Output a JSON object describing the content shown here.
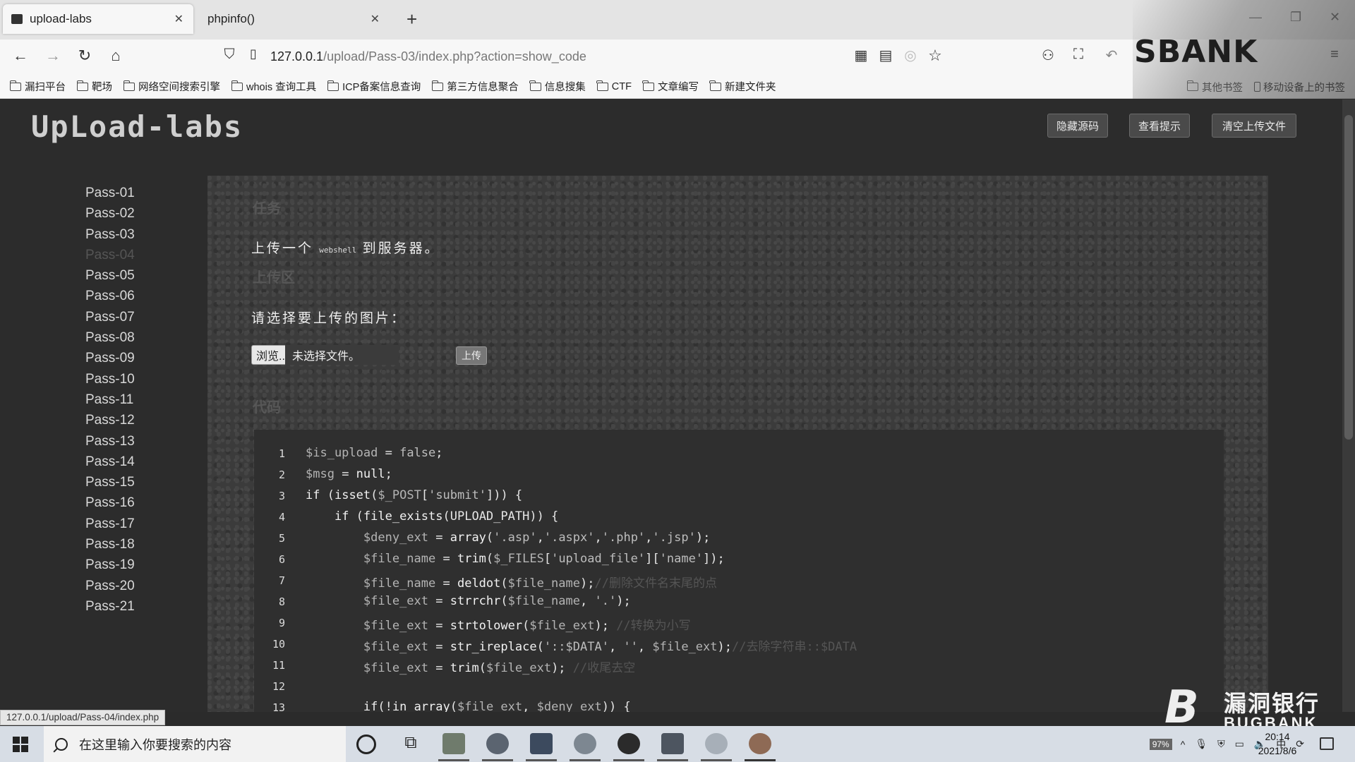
{
  "browser": {
    "tabs": [
      {
        "label": "upload-labs",
        "active": true
      },
      {
        "label": "phpinfo()",
        "active": false
      }
    ],
    "new_tab_glyph": "+",
    "address": {
      "host": "127.0.0.1",
      "path": "/upload/Pass-03/index.php?action=show_code"
    },
    "bookmarks": [
      "漏扫平台",
      "靶场",
      "网络空间搜索引擎",
      "whois 查询工具",
      "ICP备案信息查询",
      "第三方信息聚合",
      "信息搜集",
      "CTF",
      "文章编写",
      "新建文件夹"
    ],
    "bookmarks_right": [
      "其他书签",
      "移动设备上的书签"
    ],
    "overlay_logo": "SBANK"
  },
  "site": {
    "logo": "UpLoad-labs",
    "buttons": {
      "hide_source": "隐藏源码",
      "view_hint": "查看提示",
      "clear_uploads": "清空上传文件"
    },
    "menu": [
      "Pass-01",
      "Pass-02",
      "Pass-03",
      "Pass-04",
      "Pass-05",
      "Pass-06",
      "Pass-07",
      "Pass-08",
      "Pass-09",
      "Pass-10",
      "Pass-11",
      "Pass-12",
      "Pass-13",
      "Pass-14",
      "Pass-15",
      "Pass-16",
      "Pass-17",
      "Pass-18",
      "Pass-19",
      "Pass-20",
      "Pass-21"
    ],
    "task": {
      "title": "任务",
      "desc_before": "上传一个",
      "desc_code": "webshell",
      "desc_after": "到服务器。"
    },
    "upload": {
      "title": "上传区",
      "prompt": "请选择要上传的图片：",
      "browse_label": "浏览...",
      "file_status": "未选择文件。",
      "submit_label": "上传"
    },
    "code_title": "代码",
    "code_lines": [
      {
        "n": "1",
        "html": "<span class=\"v\">$is_upload</span> = <span class=\"s\">false</span>;"
      },
      {
        "n": "2",
        "html": "<span class=\"v\">$msg</span> = <span class=\"k\">null</span>;"
      },
      {
        "n": "3",
        "html": "<span class=\"k\">if</span> (<span class=\"k\">isset</span>(<span class=\"v\">$_POST</span>[<span class=\"s\">'submit'</span>])) {"
      },
      {
        "n": "4",
        "html": "    <span class=\"k\">if</span> (<span class=\"k\">file_exists</span>(UPLOAD_PATH)) {"
      },
      {
        "n": "5",
        "html": "        <span class=\"v\">$deny_ext</span> = <span class=\"k\">array</span>(<span class=\"s\">'.asp'</span>,<span class=\"s\">'.aspx'</span>,<span class=\"s\">'.php'</span>,<span class=\"s\">'.jsp'</span>);"
      },
      {
        "n": "6",
        "html": "        <span class=\"v\">$file_name</span> = <span class=\"k\">trim</span>(<span class=\"v\">$_FILES</span>[<span class=\"s\">'upload_file'</span>][<span class=\"s\">'name'</span>]);"
      },
      {
        "n": "7",
        "html": "        <span class=\"v\">$file_name</span> = <span class=\"k\">deldot</span>(<span class=\"v\">$file_name</span>);<span class=\"c\">//删除文件名末尾的点</span>"
      },
      {
        "n": "8",
        "html": "        <span class=\"v\">$file_ext</span> = <span class=\"k\">strrchr</span>(<span class=\"v\">$file_name</span>, <span class=\"s\">'.'</span>);"
      },
      {
        "n": "9",
        "html": "        <span class=\"v\">$file_ext</span> = <span class=\"k\">strtolower</span>(<span class=\"v\">$file_ext</span>); <span class=\"c\">//转换为小写</span>"
      },
      {
        "n": "10",
        "html": "        <span class=\"v\">$file_ext</span> = <span class=\"k\">str_ireplace</span>(<span class=\"s\">'::$DATA'</span>, <span class=\"s\">''</span>, <span class=\"v\">$file_ext</span>);<span class=\"c\">//去除字符串::$DATA</span>"
      },
      {
        "n": "11",
        "html": "        <span class=\"v\">$file_ext</span> = <span class=\"k\">trim</span>(<span class=\"v\">$file_ext</span>); <span class=\"c\">//收尾去空</span>"
      },
      {
        "n": "12",
        "html": ""
      },
      {
        "n": "13",
        "html": "        <span class=\"k\">if</span>(!<span class=\"k\">in_array</span>(<span class=\"v\">$file_ext</span>, <span class=\"v\">$deny_ext</span>)) {"
      }
    ]
  },
  "status_bar_url": "127.0.0.1/upload/Pass-04/index.php",
  "watermark": {
    "cn": "漏洞银行",
    "en": "BUGBANK"
  },
  "taskbar": {
    "search_placeholder": "在这里输入你要搜索的内容",
    "time": "20:14",
    "date": "2021/8/6",
    "ime": "中",
    "battery": "97%"
  }
}
